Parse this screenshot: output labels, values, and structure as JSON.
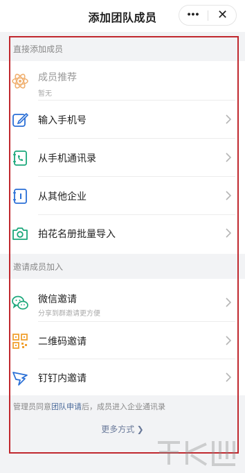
{
  "header": {
    "title": "添加团队成员",
    "more_label": "•••",
    "close_label": "✕"
  },
  "sections": {
    "direct_add": "直接添加成员",
    "invite": "邀请成员加入"
  },
  "direct_items": [
    {
      "label": "成员推荐",
      "sub": "暂无",
      "icon": "atom-icon",
      "disabled": true
    },
    {
      "label": "输入手机号",
      "icon": "edit-icon"
    },
    {
      "label": "从手机通讯录",
      "icon": "phone-book-icon"
    },
    {
      "label": "从其他企业",
      "icon": "company-book-icon"
    },
    {
      "label": "拍花名册批量导入",
      "icon": "camera-icon"
    }
  ],
  "invite_items": [
    {
      "label": "微信邀请",
      "sub": "分享到群邀请更方便",
      "icon": "wechat-icon"
    },
    {
      "label": "二维码邀请",
      "icon": "qrcode-icon"
    },
    {
      "label": "钉钉内邀请",
      "icon": "dingtalk-icon"
    }
  ],
  "footer": {
    "note_pre": "管理员同意",
    "note_link": "团队申请",
    "note_post": "后，成员进入企业通讯录",
    "more_ways": "更多方式 ❯"
  },
  "colors": {
    "accent_teal": "#1aa77a",
    "accent_blue": "#2a6fd6",
    "accent_orange": "#f0a030",
    "highlight": "#c0272d"
  }
}
